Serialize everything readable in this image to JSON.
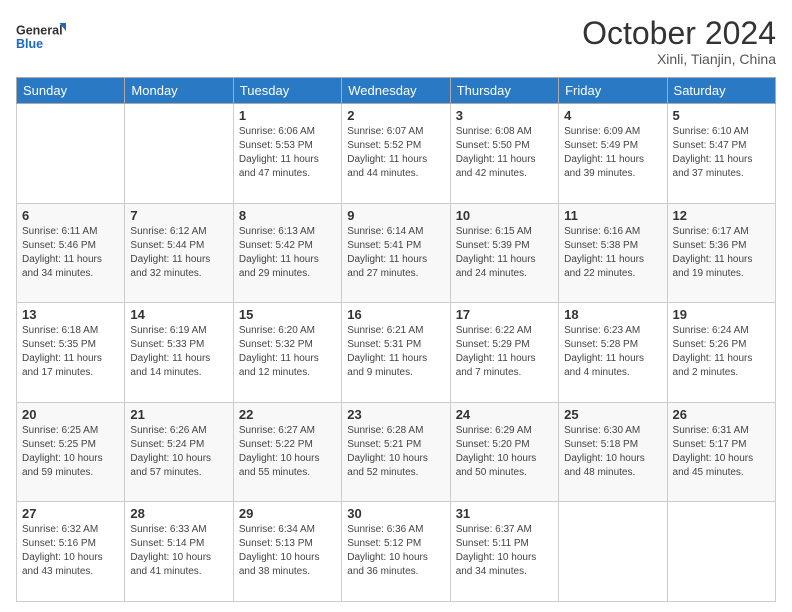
{
  "logo": {
    "line1": "General",
    "line2": "Blue"
  },
  "title": "October 2024",
  "subtitle": "Xinli, Tianjin, China",
  "days_header": [
    "Sunday",
    "Monday",
    "Tuesday",
    "Wednesday",
    "Thursday",
    "Friday",
    "Saturday"
  ],
  "weeks": [
    [
      null,
      null,
      {
        "day": 1,
        "sunrise": "6:06 AM",
        "sunset": "5:53 PM",
        "daylight": "11 hours and 47 minutes."
      },
      {
        "day": 2,
        "sunrise": "6:07 AM",
        "sunset": "5:52 PM",
        "daylight": "11 hours and 44 minutes."
      },
      {
        "day": 3,
        "sunrise": "6:08 AM",
        "sunset": "5:50 PM",
        "daylight": "11 hours and 42 minutes."
      },
      {
        "day": 4,
        "sunrise": "6:09 AM",
        "sunset": "5:49 PM",
        "daylight": "11 hours and 39 minutes."
      },
      {
        "day": 5,
        "sunrise": "6:10 AM",
        "sunset": "5:47 PM",
        "daylight": "11 hours and 37 minutes."
      }
    ],
    [
      {
        "day": 6,
        "sunrise": "6:11 AM",
        "sunset": "5:46 PM",
        "daylight": "11 hours and 34 minutes."
      },
      {
        "day": 7,
        "sunrise": "6:12 AM",
        "sunset": "5:44 PM",
        "daylight": "11 hours and 32 minutes."
      },
      {
        "day": 8,
        "sunrise": "6:13 AM",
        "sunset": "5:42 PM",
        "daylight": "11 hours and 29 minutes."
      },
      {
        "day": 9,
        "sunrise": "6:14 AM",
        "sunset": "5:41 PM",
        "daylight": "11 hours and 27 minutes."
      },
      {
        "day": 10,
        "sunrise": "6:15 AM",
        "sunset": "5:39 PM",
        "daylight": "11 hours and 24 minutes."
      },
      {
        "day": 11,
        "sunrise": "6:16 AM",
        "sunset": "5:38 PM",
        "daylight": "11 hours and 22 minutes."
      },
      {
        "day": 12,
        "sunrise": "6:17 AM",
        "sunset": "5:36 PM",
        "daylight": "11 hours and 19 minutes."
      }
    ],
    [
      {
        "day": 13,
        "sunrise": "6:18 AM",
        "sunset": "5:35 PM",
        "daylight": "11 hours and 17 minutes."
      },
      {
        "day": 14,
        "sunrise": "6:19 AM",
        "sunset": "5:33 PM",
        "daylight": "11 hours and 14 minutes."
      },
      {
        "day": 15,
        "sunrise": "6:20 AM",
        "sunset": "5:32 PM",
        "daylight": "11 hours and 12 minutes."
      },
      {
        "day": 16,
        "sunrise": "6:21 AM",
        "sunset": "5:31 PM",
        "daylight": "11 hours and 9 minutes."
      },
      {
        "day": 17,
        "sunrise": "6:22 AM",
        "sunset": "5:29 PM",
        "daylight": "11 hours and 7 minutes."
      },
      {
        "day": 18,
        "sunrise": "6:23 AM",
        "sunset": "5:28 PM",
        "daylight": "11 hours and 4 minutes."
      },
      {
        "day": 19,
        "sunrise": "6:24 AM",
        "sunset": "5:26 PM",
        "daylight": "11 hours and 2 minutes."
      }
    ],
    [
      {
        "day": 20,
        "sunrise": "6:25 AM",
        "sunset": "5:25 PM",
        "daylight": "10 hours and 59 minutes."
      },
      {
        "day": 21,
        "sunrise": "6:26 AM",
        "sunset": "5:24 PM",
        "daylight": "10 hours and 57 minutes."
      },
      {
        "day": 22,
        "sunrise": "6:27 AM",
        "sunset": "5:22 PM",
        "daylight": "10 hours and 55 minutes."
      },
      {
        "day": 23,
        "sunrise": "6:28 AM",
        "sunset": "5:21 PM",
        "daylight": "10 hours and 52 minutes."
      },
      {
        "day": 24,
        "sunrise": "6:29 AM",
        "sunset": "5:20 PM",
        "daylight": "10 hours and 50 minutes."
      },
      {
        "day": 25,
        "sunrise": "6:30 AM",
        "sunset": "5:18 PM",
        "daylight": "10 hours and 48 minutes."
      },
      {
        "day": 26,
        "sunrise": "6:31 AM",
        "sunset": "5:17 PM",
        "daylight": "10 hours and 45 minutes."
      }
    ],
    [
      {
        "day": 27,
        "sunrise": "6:32 AM",
        "sunset": "5:16 PM",
        "daylight": "10 hours and 43 minutes."
      },
      {
        "day": 28,
        "sunrise": "6:33 AM",
        "sunset": "5:14 PM",
        "daylight": "10 hours and 41 minutes."
      },
      {
        "day": 29,
        "sunrise": "6:34 AM",
        "sunset": "5:13 PM",
        "daylight": "10 hours and 38 minutes."
      },
      {
        "day": 30,
        "sunrise": "6:36 AM",
        "sunset": "5:12 PM",
        "daylight": "10 hours and 36 minutes."
      },
      {
        "day": 31,
        "sunrise": "6:37 AM",
        "sunset": "5:11 PM",
        "daylight": "10 hours and 34 minutes."
      },
      null,
      null
    ]
  ],
  "labels": {
    "sunrise_prefix": "Sunrise: ",
    "sunset_prefix": "Sunset: ",
    "daylight_prefix": "Daylight: "
  }
}
